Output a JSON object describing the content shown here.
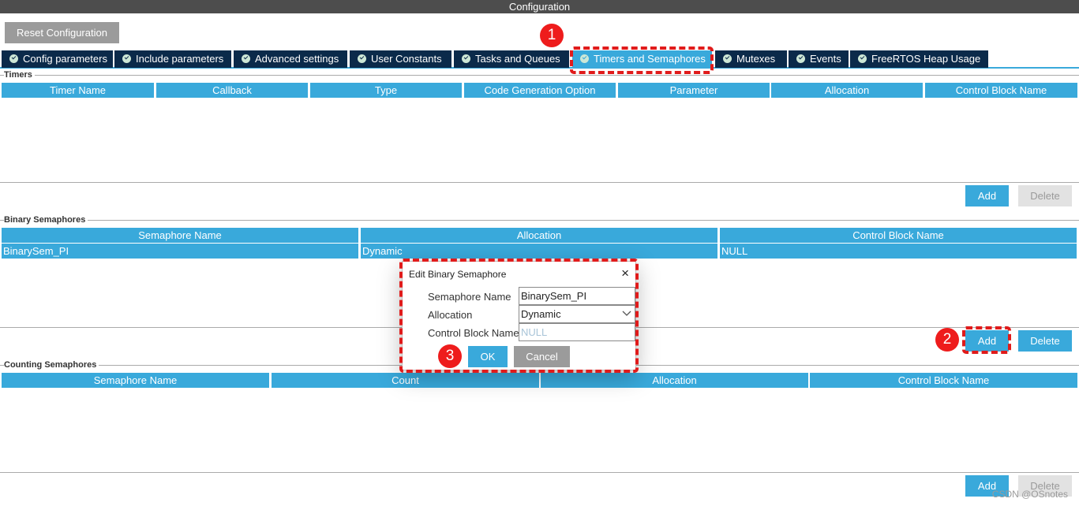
{
  "window": {
    "title": "Configuration"
  },
  "toolbar": {
    "reset_label": "Reset Configuration"
  },
  "tabs": [
    {
      "label": "Config parameters"
    },
    {
      "label": "Include parameters"
    },
    {
      "label": "Advanced settings"
    },
    {
      "label": "User Constants"
    },
    {
      "label": "Tasks and Queues"
    },
    {
      "label": "Timers and Semaphores",
      "active": true
    },
    {
      "label": "Mutexes"
    },
    {
      "label": "Events"
    },
    {
      "label": "FreeRTOS Heap Usage"
    }
  ],
  "timers": {
    "title": "Timers",
    "columns": [
      "Timer Name",
      "Callback",
      "Type",
      "Code Generation Option",
      "Parameter",
      "Allocation",
      "Control Block Name"
    ],
    "add_label": "Add",
    "delete_label": "Delete"
  },
  "binary_semaphores": {
    "title": "Binary Semaphores",
    "columns": [
      "Semaphore Name",
      "Allocation",
      "Control Block Name"
    ],
    "rows": [
      [
        "BinarySem_PI",
        "Dynamic",
        "NULL"
      ]
    ],
    "add_label": "Add",
    "delete_label": "Delete"
  },
  "counting_semaphores": {
    "title": "Counting Semaphores",
    "columns": [
      "Semaphore Name",
      "Count",
      "Allocation",
      "Control Block Name"
    ],
    "add_label": "Add",
    "delete_label": "Delete"
  },
  "dialog": {
    "title": "Edit Binary Semaphore",
    "close_icon": "×",
    "fields": [
      {
        "label": "Semaphore Name",
        "value": "BinarySem_PI"
      },
      {
        "label": "Allocation",
        "value": "Dynamic"
      },
      {
        "label": "Control Block Name",
        "placeholder": "NULL"
      }
    ],
    "ok_label": "OK",
    "cancel_label": "Cancel"
  },
  "annotations": {
    "step1": "1",
    "step2": "2",
    "step3": "3"
  },
  "watermark": "CSDN @OSnotes",
  "colors": {
    "accent": "#39a9db",
    "tab_dark": "#0b2a4a",
    "title_bar": "#4d4d4d",
    "marker_red": "#ee1c1c",
    "disabled_bg": "#e2e2e2"
  }
}
